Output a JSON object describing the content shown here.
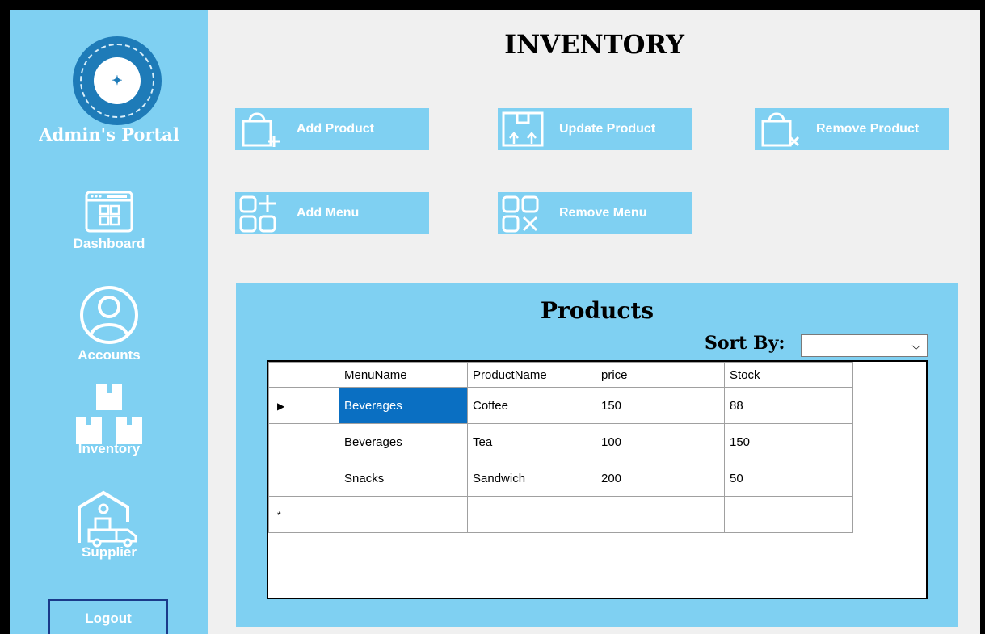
{
  "window": {
    "title": "INVENTORY"
  },
  "sidebar": {
    "portal_title": "Admin's Portal",
    "items": [
      {
        "label": "Dashboard",
        "icon": "dashboard-icon"
      },
      {
        "label": "Accounts",
        "icon": "user-circle-icon"
      },
      {
        "label": "Inventory",
        "icon": "boxes-icon"
      },
      {
        "label": "Supplier",
        "icon": "warehouse-truck-icon"
      }
    ],
    "logout_label": "Logout"
  },
  "actions": {
    "add_product": "Add Product",
    "update_product": "Update Product",
    "remove_product": "Remove Product",
    "add_menu": "Add Menu",
    "remove_menu": "Remove Menu"
  },
  "products": {
    "title": "Products",
    "sort_label": "Sort By:",
    "sort_value": "",
    "columns": [
      "MenuName",
      "ProductName",
      "price",
      "Stock"
    ],
    "rows": [
      [
        "Beverages",
        "Coffee",
        "150",
        "88"
      ],
      [
        "Beverages",
        "Tea",
        "100",
        "150"
      ],
      [
        "Snacks",
        "Sandwich",
        "200",
        "50"
      ]
    ],
    "current_row_marker": "▶",
    "new_row_marker": "*"
  },
  "colors": {
    "panel": "#7fd0f2",
    "selected_cell": "#0a6fc2",
    "logout_border": "#1a3a8a"
  }
}
